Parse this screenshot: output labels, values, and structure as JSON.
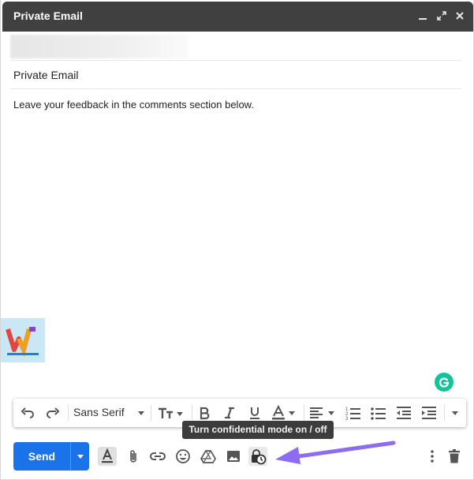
{
  "window": {
    "title": "Private Email"
  },
  "subject": "Private Email",
  "body": "Leave your feedback in the comments section below.",
  "format_bar": {
    "font_name": "Sans Serif"
  },
  "tooltip": "Turn confidential mode on / off",
  "send": {
    "label": "Send"
  },
  "colors": {
    "titlebar": "#404040",
    "send": "#1a73e8",
    "arrow": "#8b6cf2",
    "grammarly": "#15c39a"
  },
  "icons": [
    "minimize-icon",
    "fullscreen-icon",
    "close-icon",
    "undo-icon",
    "redo-icon",
    "text-size-icon",
    "bold-icon",
    "italic-icon",
    "underline-icon",
    "text-color-icon",
    "align-icon",
    "numbered-list-icon",
    "bulleted-list-icon",
    "indent-less-icon",
    "indent-more-icon",
    "formatting-options-icon",
    "attach-icon",
    "link-icon",
    "emoji-icon",
    "drive-icon",
    "photo-icon",
    "confidential-mode-icon",
    "more-options-icon",
    "discard-icon"
  ]
}
